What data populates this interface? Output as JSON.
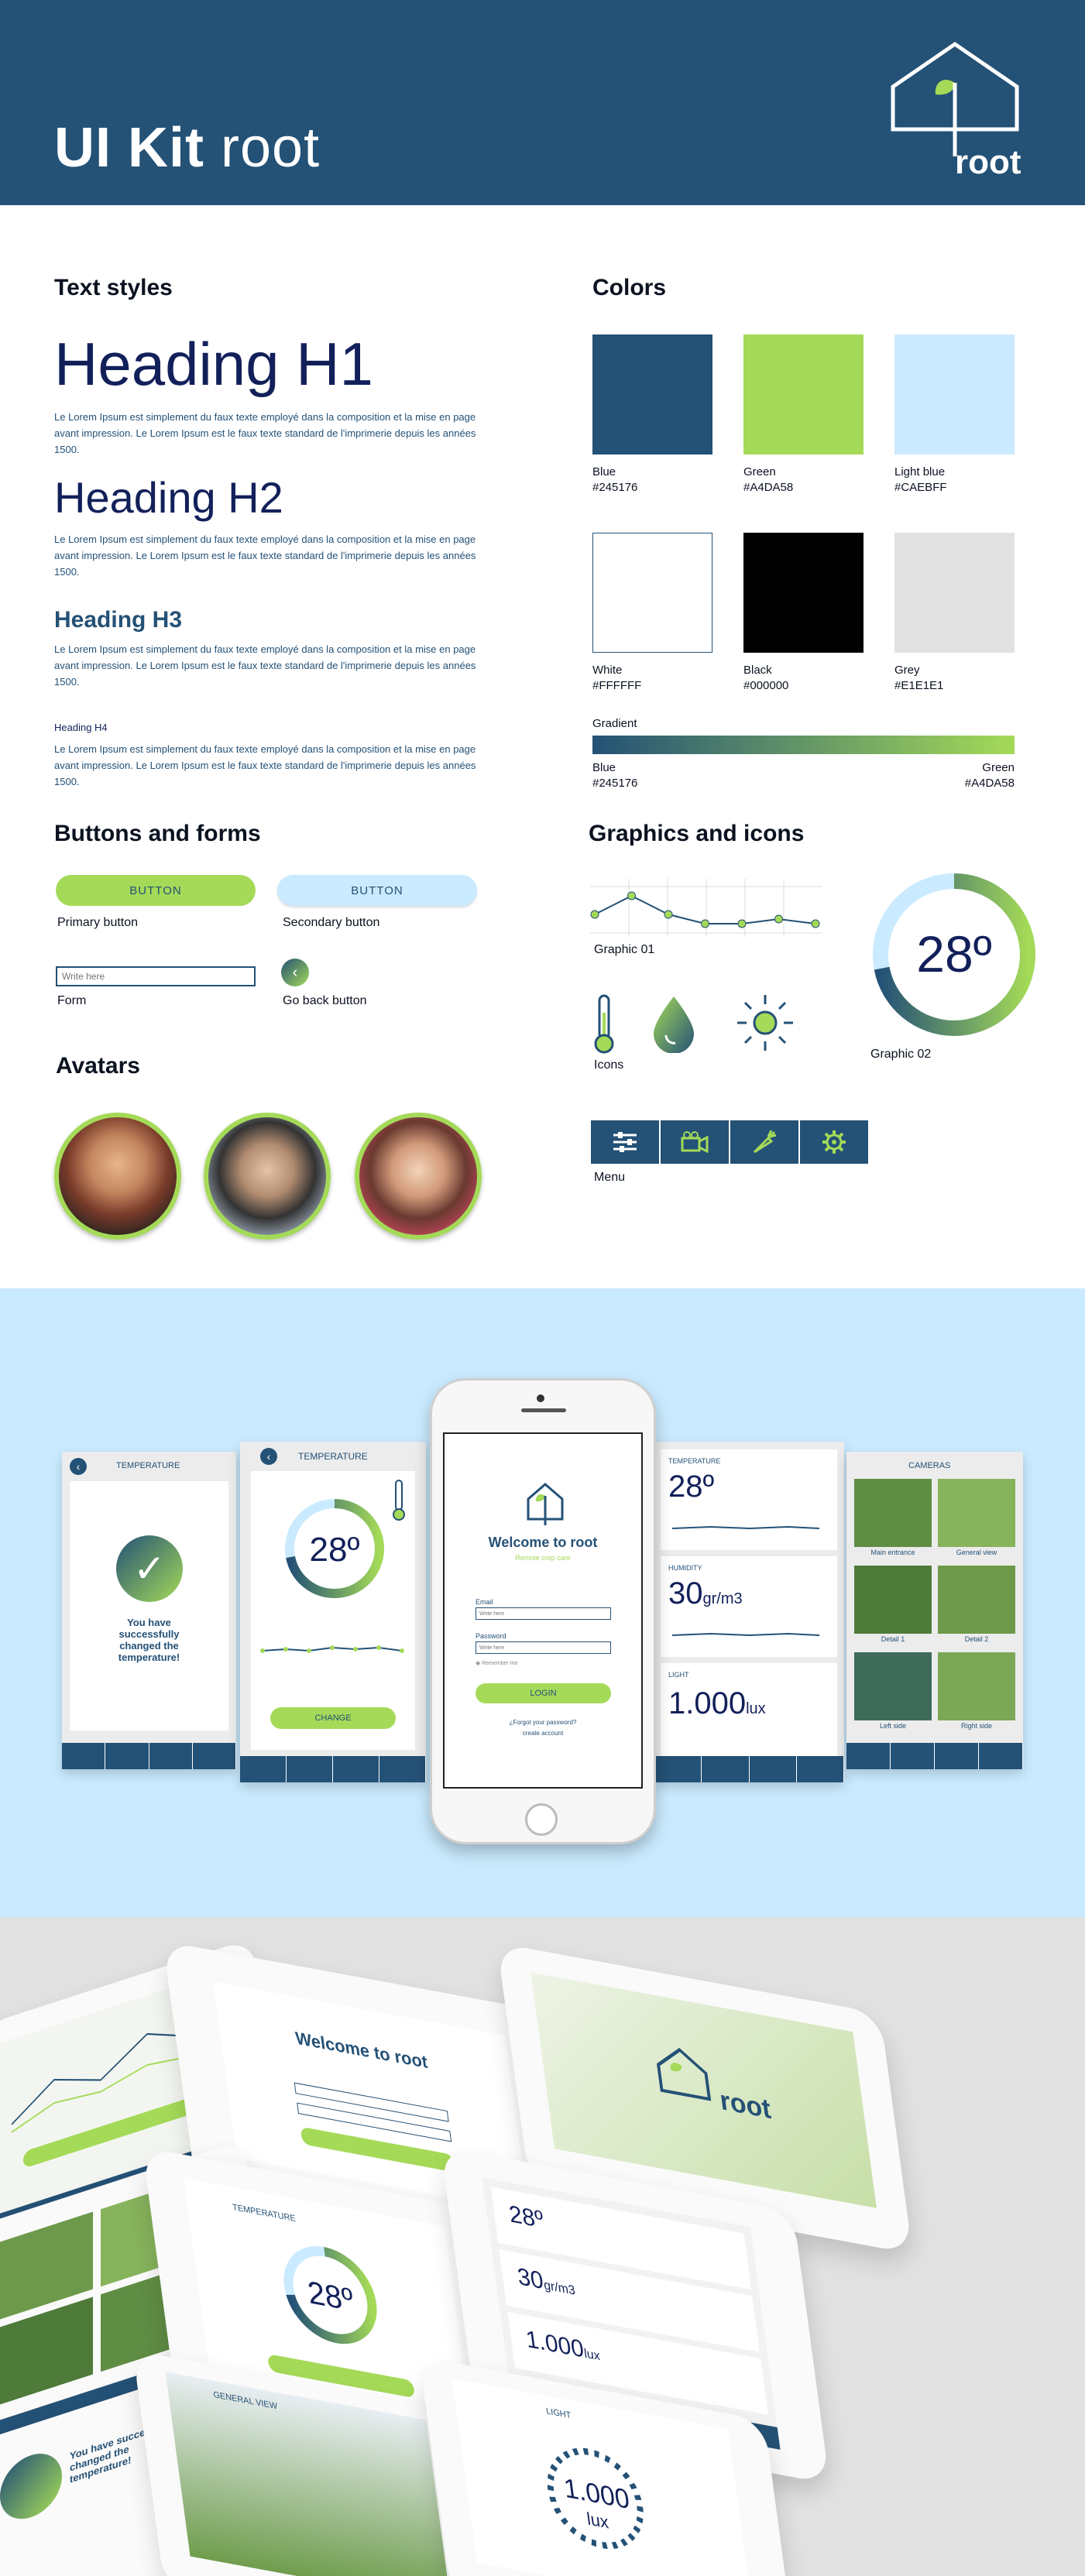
{
  "header": {
    "title_bold": "UI Kit",
    "title_light": "root",
    "logo_text": "root"
  },
  "text_styles": {
    "title": "Text styles",
    "h1": "Heading H1",
    "h2": "Heading H2",
    "h3": "Heading H3",
    "h4": "Heading H4",
    "body": "Le Lorem Ipsum est simplement du faux texte employé dans la composition et la mise en page avant impression. Le Lorem Ipsum est le faux texte standard de l'imprimerie depuis les années 1500."
  },
  "colors": {
    "title": "Colors",
    "swatches": [
      {
        "name": "Blue",
        "hex": "#245176"
      },
      {
        "name": "Green",
        "hex": "#A4DA58"
      },
      {
        "name": "Light blue",
        "hex": "#CAEBFF"
      },
      {
        "name": "White",
        "hex": "#FFFFFF"
      },
      {
        "name": "Black",
        "hex": "#000000"
      },
      {
        "name": "Grey",
        "hex": "#E1E1E1"
      }
    ],
    "gradient_label": "Gradient",
    "gradient_start_name": "Blue",
    "gradient_start_hex": "#245176",
    "gradient_end_name": "Green",
    "gradient_end_hex": "#A4DA58"
  },
  "buttons": {
    "title": "Buttons and forms",
    "primary_text": "BUTTON",
    "primary_label": "Primary button",
    "secondary_text": "BUTTON",
    "secondary_label": "Secondary button",
    "form_placeholder": "Write here",
    "form_label": "Form",
    "back_label": "Go back button"
  },
  "avatars": {
    "title": "Avatars"
  },
  "graphics": {
    "title": "Graphics and icons",
    "graphic01_label": "Graphic 01",
    "graphic02_value": "28º",
    "graphic02_label": "Graphic 02",
    "icons_label": "Icons",
    "menu_label": "Menu",
    "graphic01_points": [
      2,
      4,
      2,
      1,
      1,
      1.5,
      1
    ],
    "graphic02_fraction": 0.72
  },
  "showcase": {
    "temp_title": "TEMPERATURE",
    "success_text": "You have successfully changed the temperature!",
    "temp_value": "28º",
    "change_btn": "CHANGE",
    "welcome_title": "Welcome to root",
    "welcome_sub": "Remote crop care",
    "email_label": "Email",
    "email_placeholder": "Write here",
    "password_label": "Password",
    "password_placeholder": "Write here",
    "remember_label": "Remember me",
    "login_btn": "LOGIN",
    "forgot_text": "¿Forgot your password?",
    "create_text": "create account",
    "card_temp_label": "TEMPERATURE",
    "card_temp_value": "28º",
    "card_hum_label": "HUMIDITY",
    "card_hum_value": "30",
    "card_hum_unit": "gr/m3",
    "card_light_label": "LIGHT",
    "card_light_value": "1.000",
    "card_light_unit": "lux",
    "cameras_title": "CAMERAS",
    "cameras": [
      "Main entrance",
      "General view",
      "Detail 1",
      "Detail 2",
      "Left side",
      "Right side"
    ],
    "iso_welcome": "Welcome to root",
    "iso_logo": "root",
    "iso_temp_title": "TEMPERATURE",
    "iso_temp_value": "28º",
    "iso_general": "GENERAL VIEW",
    "iso_light": "LIGHT",
    "iso_lux": "1.000",
    "iso_lux_unit": "lux",
    "iso_card_temp": "28º",
    "iso_card_hum": "30",
    "iso_card_hum_unit": "gr/m3",
    "iso_card_lux": "1.000",
    "iso_card_lux_unit": "lux",
    "iso_success": "You have successfully changed the temperature!"
  }
}
